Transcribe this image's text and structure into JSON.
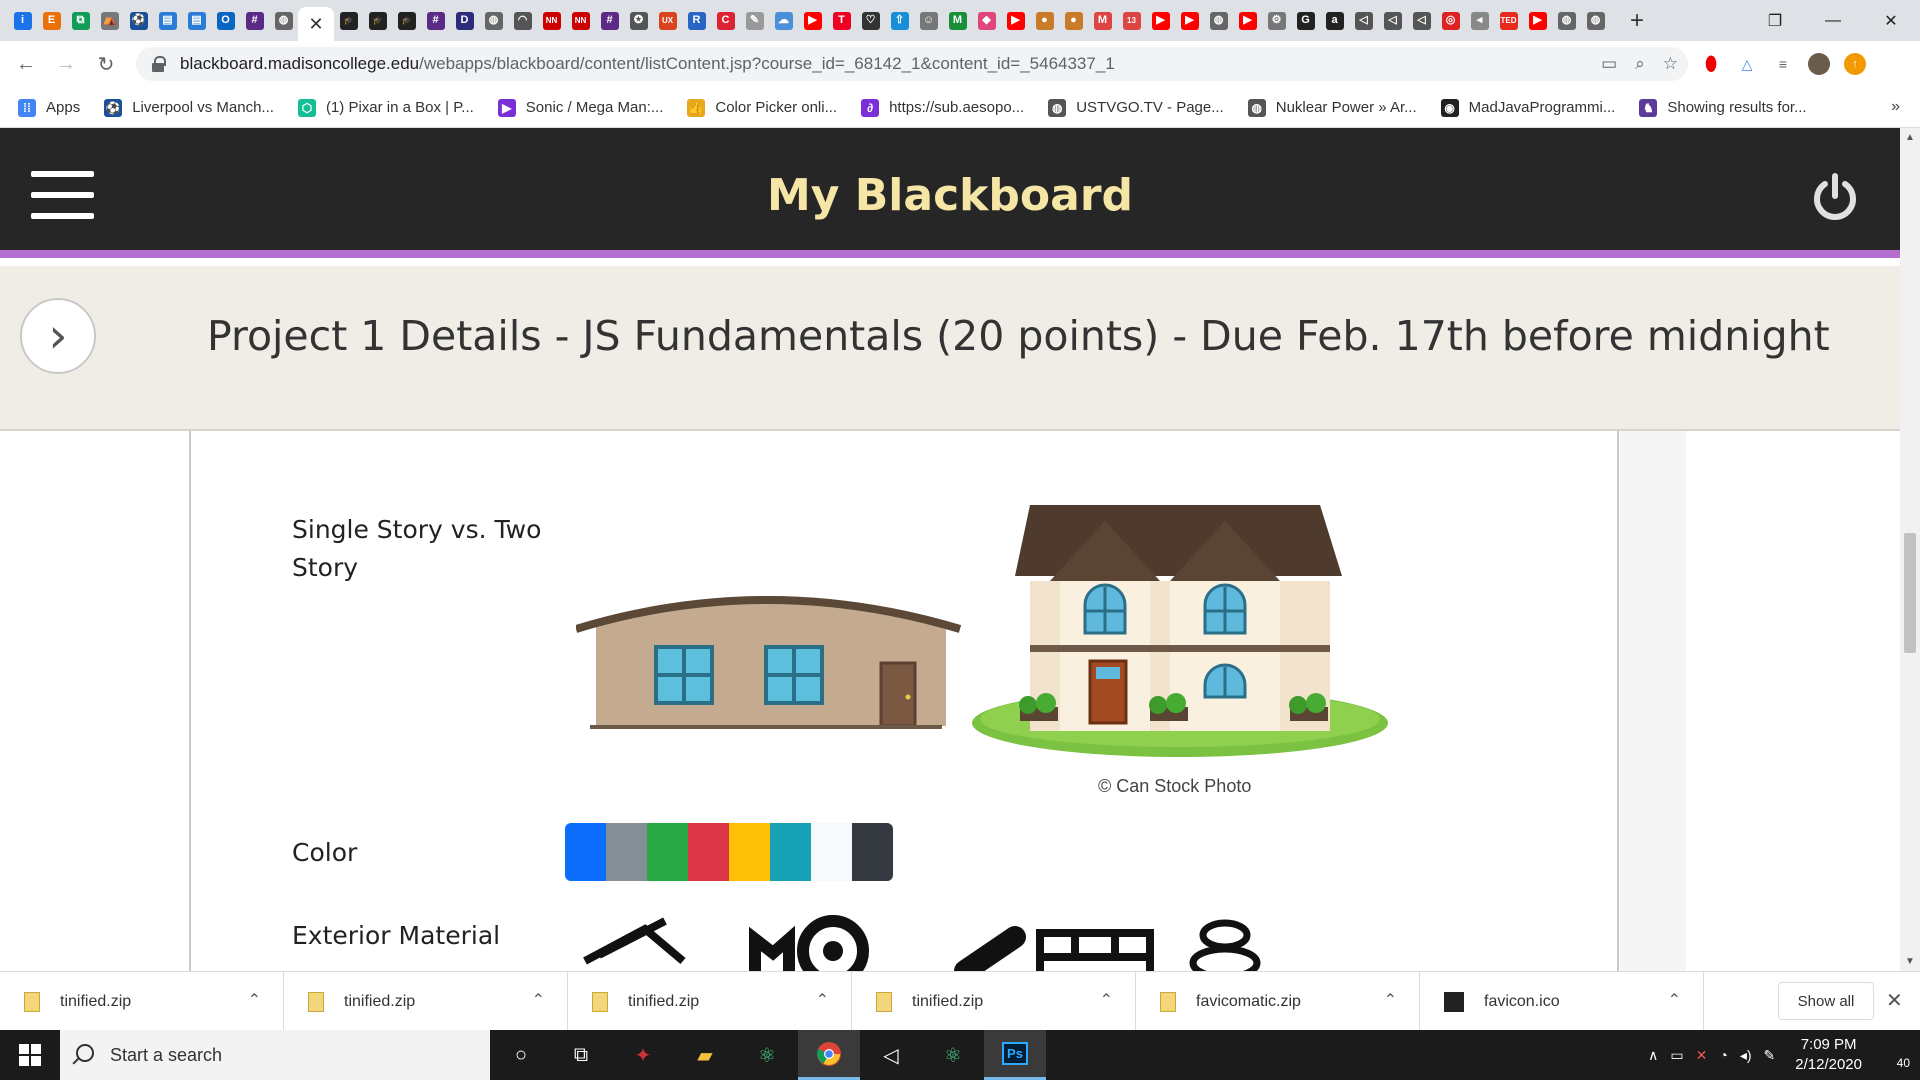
{
  "browser": {
    "tab_favicons": [
      {
        "name": "info-favicon",
        "glyph": "i",
        "bg": "#1a73e8"
      },
      {
        "name": "e-favicon",
        "glyph": "E",
        "bg": "#e8710a"
      },
      {
        "name": "blue-favicon",
        "glyph": "⧉",
        "bg": "#0f9d58"
      },
      {
        "name": "tent-favicon",
        "glyph": "⛺",
        "bg": "#777"
      },
      {
        "name": "soccer-favicon",
        "glyph": "⚽",
        "bg": "#1a4f9c"
      },
      {
        "name": "file-favicon",
        "glyph": "▤",
        "bg": "#2b7bd8"
      },
      {
        "name": "file2-favicon",
        "glyph": "▤",
        "bg": "#2b7bd8"
      },
      {
        "name": "outlook-favicon",
        "glyph": "O",
        "bg": "#0a64c2"
      },
      {
        "name": "grid-favicon",
        "glyph": "#",
        "bg": "#5b2a86"
      },
      {
        "name": "globe-favicon",
        "glyph": "◍",
        "bg": "#666"
      }
    ],
    "active_tab_close": "✕",
    "tab_favicons_right": [
      {
        "name": "mortarboard-favicon",
        "glyph": "🎓",
        "bg": "#222"
      },
      {
        "name": "mortarboard2-favicon",
        "glyph": "🎓",
        "bg": "#222"
      },
      {
        "name": "mortarboard3-favicon",
        "glyph": "🎓",
        "bg": "#222"
      },
      {
        "name": "grid2-favicon",
        "glyph": "#",
        "bg": "#5b2a86"
      },
      {
        "name": "dansdoll-favicon",
        "glyph": "D",
        "bg": "#2c2c7a"
      },
      {
        "name": "globe2-favicon",
        "glyph": "◍",
        "bg": "#666"
      },
      {
        "name": "rainbow-favicon",
        "glyph": "◠",
        "bg": "#555"
      },
      {
        "name": "nn-favicon",
        "glyph": "NN",
        "bg": "#c00"
      },
      {
        "name": "nn2-favicon",
        "glyph": "NN",
        "bg": "#c00"
      },
      {
        "name": "grid3-favicon",
        "glyph": "#",
        "bg": "#5b2a86"
      },
      {
        "name": "star-favicon",
        "glyph": "✪",
        "bg": "#555"
      },
      {
        "name": "ux-favicon",
        "glyph": "UX",
        "bg": "#d9431e"
      },
      {
        "name": "r-favicon",
        "glyph": "R",
        "bg": "#2965c4"
      },
      {
        "name": "c-favicon",
        "glyph": "C",
        "bg": "#d23"
      },
      {
        "name": "paint-favicon",
        "glyph": "✎",
        "bg": "#999"
      },
      {
        "name": "cloud-favicon",
        "glyph": "☁",
        "bg": "#4a90d9"
      },
      {
        "name": "youtube-favicon",
        "glyph": "▶",
        "bg": "#f00"
      },
      {
        "name": "t-favicon",
        "glyph": "T",
        "bg": "#e02"
      },
      {
        "name": "heart-favicon",
        "glyph": "♡",
        "bg": "#333"
      },
      {
        "name": "arrow-favicon",
        "glyph": "⇧",
        "bg": "#1a8fd9"
      },
      {
        "name": "mask-favicon",
        "glyph": "☺",
        "bg": "#777"
      },
      {
        "name": "m-favicon",
        "glyph": "M",
        "bg": "#1a8f3a"
      },
      {
        "name": "diamond-favicon",
        "glyph": "◆",
        "bg": "#e0457b"
      },
      {
        "name": "youtube2-favicon",
        "glyph": "▶",
        "bg": "#f00"
      },
      {
        "name": "cookie-favicon",
        "glyph": "●",
        "bg": "#c97b2a"
      },
      {
        "name": "cookie2-favicon",
        "glyph": "●",
        "bg": "#c97b2a"
      },
      {
        "name": "gmail-favicon",
        "glyph": "M",
        "bg": "#d44"
      },
      {
        "name": "calendar-favicon",
        "glyph": "13",
        "bg": "#d44"
      },
      {
        "name": "youtube3-favicon",
        "glyph": "▶",
        "bg": "#f00"
      },
      {
        "name": "youtube4-favicon",
        "glyph": "▶",
        "bg": "#f00"
      },
      {
        "name": "globe3-favicon",
        "glyph": "◍",
        "bg": "#666"
      },
      {
        "name": "youtube5-favicon",
        "glyph": "▶",
        "bg": "#f00"
      },
      {
        "name": "gear-favicon",
        "glyph": "⚙",
        "bg": "#777"
      },
      {
        "name": "g-favicon",
        "glyph": "G",
        "bg": "#222"
      },
      {
        "name": "amazon-favicon",
        "glyph": "a",
        "bg": "#222"
      },
      {
        "name": "vs-favicon",
        "glyph": "◁",
        "bg": "#555"
      },
      {
        "name": "vs2-favicon",
        "glyph": "◁",
        "bg": "#555"
      },
      {
        "name": "vs3-favicon",
        "glyph": "◁",
        "bg": "#555"
      },
      {
        "name": "target-favicon",
        "glyph": "◎",
        "bg": "#d22"
      },
      {
        "name": "speaker-favicon",
        "glyph": "◂",
        "bg": "#888"
      },
      {
        "name": "ted-favicon",
        "glyph": "TED",
        "bg": "#e62b1e"
      },
      {
        "name": "youtube6-favicon",
        "glyph": "▶",
        "bg": "#f00"
      },
      {
        "name": "globe4-favicon",
        "glyph": "◍",
        "bg": "#666"
      },
      {
        "name": "globe5-favicon",
        "glyph": "◍",
        "bg": "#666"
      }
    ],
    "new_tab": "+",
    "window_controls": {
      "minimize": "—",
      "maximize": "❐",
      "close": "✕"
    },
    "url_domain": "blackboard.madisoncollege.edu",
    "url_path": "/webapps/blackboard/content/listContent.jsp?course_id=_68142_1&content_id=_5464337_1",
    "bookmarks": [
      {
        "label": "Apps",
        "icon": "apps-icon",
        "color": "#4285f4",
        "glyph": "⁞⁞"
      },
      {
        "label": "Liverpool vs Manch...",
        "icon": "soccer-ball-icon",
        "color": "#1a4f9c",
        "glyph": "⚽"
      },
      {
        "label": "(1) Pixar in a Box | P...",
        "icon": "khan-academy-icon",
        "color": "#14bf96",
        "glyph": "⬡"
      },
      {
        "label": "Sonic / Mega Man:...",
        "icon": "play-store-icon",
        "color": "#7b2fd9",
        "glyph": "▶"
      },
      {
        "label": "Color Picker onli...",
        "icon": "thumbs-up-icon",
        "color": "#e6a91a",
        "glyph": "👍"
      },
      {
        "label": "https://sub.aesopo...",
        "icon": "link-icon",
        "color": "#7b2fd9",
        "glyph": "∂"
      },
      {
        "label": "USTVGO.TV - Page...",
        "icon": "globe-icon",
        "color": "#555",
        "glyph": "◍"
      },
      {
        "label": "Nuklear Power » Ar...",
        "icon": "globe-icon",
        "color": "#555",
        "glyph": "◍"
      },
      {
        "label": "MadJavaProgrammi...",
        "icon": "github-icon",
        "color": "#222",
        "glyph": "◉"
      },
      {
        "label": "Showing results for...",
        "icon": "wolf-icon",
        "color": "#5b3a99",
        "glyph": "♞"
      }
    ],
    "bookmarks_more": "»"
  },
  "header": {
    "title": "My Blackboard",
    "accent": "#b56fd0",
    "title_color": "#f5e6a6"
  },
  "page": {
    "title": "Project 1 Details - JS Fundamentals (20 points) - Due Feb. 17th before midnight",
    "toggle_glyph": "›"
  },
  "content": {
    "labels": {
      "story": "Single Story vs. Two Story",
      "color": "Color",
      "exterior": "Exterior Material"
    },
    "image_credit": "© Can Stock Photo",
    "swatches": [
      "#0d6efd",
      "#868e96",
      "#28a745",
      "#dc3545",
      "#ffc107",
      "#17a2b8",
      "#f8f9fa",
      "#343a40"
    ]
  },
  "downloads": {
    "items": [
      {
        "name": "tinified.zip",
        "type": "zip"
      },
      {
        "name": "tinified.zip",
        "type": "zip"
      },
      {
        "name": "tinified.zip",
        "type": "zip"
      },
      {
        "name": "tinified.zip",
        "type": "zip"
      },
      {
        "name": "favicomatic.zip",
        "type": "zip"
      },
      {
        "name": "favicon.ico",
        "type": "ico"
      }
    ],
    "show_all": "Show all",
    "close": "✕"
  },
  "taskbar": {
    "search_placeholder": "Start a search",
    "time": "7:09 PM",
    "date": "2/12/2020",
    "notification_count": "40"
  }
}
